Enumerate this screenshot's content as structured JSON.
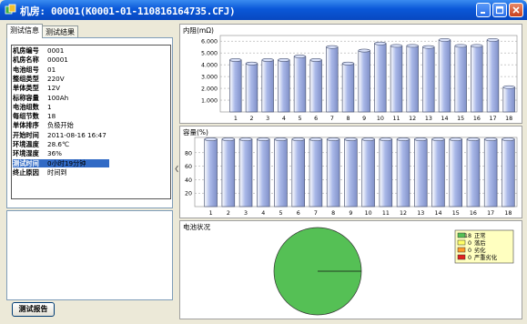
{
  "window": {
    "title": "机房: 00001(K0001-01-110816164735.CFJ)",
    "controls": [
      "minimize",
      "maximize",
      "close"
    ]
  },
  "tabs": [
    {
      "label": "测试信息",
      "active": true
    },
    {
      "label": "测试结果",
      "active": false
    }
  ],
  "info": [
    {
      "label": "机房编号",
      "value": "0001"
    },
    {
      "label": "机房名称",
      "value": "00001"
    },
    {
      "label": "电池组号",
      "value": "01"
    },
    {
      "label": "整组类型",
      "value": "220V"
    },
    {
      "label": "单体类型",
      "value": "12V"
    },
    {
      "label": "标称容量",
      "value": "100Ah"
    },
    {
      "label": "电池组数",
      "value": "1"
    },
    {
      "label": "每组节数",
      "value": "18"
    },
    {
      "label": "单体排序",
      "value": "负极开始"
    },
    {
      "label": "开始时间",
      "value": "2011-08-16 16:47"
    },
    {
      "label": "环境温度",
      "value": "28.6℃"
    },
    {
      "label": "环境湿度",
      "value": "36%"
    },
    {
      "label": "测试时间",
      "value": "0小时19分钟",
      "selected": true
    },
    {
      "label": "终止原因",
      "value": "时间到"
    }
  ],
  "report_button": "测试报告",
  "colors": {
    "bar": "#a9b8e8",
    "pie": "#55c055",
    "titlebar": "#0a58d8"
  },
  "chart_data": [
    {
      "type": "bar",
      "title": "内阻(mΩ)",
      "categories": [
        "1",
        "2",
        "3",
        "4",
        "5",
        "6",
        "7",
        "8",
        "9",
        "10",
        "11",
        "12",
        "13",
        "14",
        "15",
        "16",
        "17",
        "18"
      ],
      "values": [
        4.4,
        4.1,
        4.4,
        4.4,
        4.7,
        4.4,
        5.5,
        4.1,
        5.2,
        5.8,
        5.6,
        5.6,
        5.5,
        6.1,
        5.6,
        5.6,
        6.1,
        2.1
      ],
      "ylim": [
        0,
        6.4
      ],
      "yticks": [
        "1.000",
        "2.000",
        "3.000",
        "4.000",
        "5.000",
        "6.000"
      ],
      "grid": true
    },
    {
      "type": "bar",
      "title": "容量(%)",
      "categories": [
        "1",
        "2",
        "3",
        "4",
        "5",
        "6",
        "7",
        "8",
        "9",
        "10",
        "11",
        "12",
        "13",
        "14",
        "15",
        "16",
        "17",
        "18"
      ],
      "values": [
        100,
        100,
        100,
        100,
        100,
        100,
        100,
        100,
        100,
        100,
        100,
        100,
        100,
        100,
        100,
        100,
        100,
        100
      ],
      "ylim": [
        0,
        100
      ],
      "yticks": [
        "20",
        "40",
        "60",
        "80"
      ],
      "grid": true
    },
    {
      "type": "pie",
      "title": "电池状况",
      "legend_position": "top-right",
      "series": [
        {
          "name": "正常",
          "value": 18,
          "color": "#55c055"
        },
        {
          "name": "落后",
          "value": 0,
          "color": "#ffff66"
        },
        {
          "name": "劣化",
          "value": 0,
          "color": "#ff9a2a"
        },
        {
          "name": "严重劣化",
          "value": 0,
          "color": "#e02020"
        }
      ]
    }
  ]
}
